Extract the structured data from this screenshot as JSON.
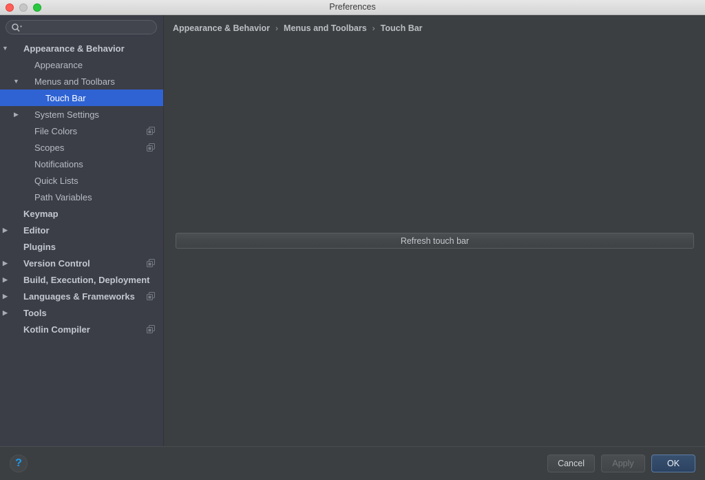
{
  "window": {
    "title": "Preferences",
    "traffic_lights": [
      "close-button",
      "minimize-button",
      "zoom-button"
    ]
  },
  "sidebar": {
    "search": {
      "value": "",
      "placeholder": "",
      "icon": "search-icon"
    },
    "items": [
      {
        "label": "Appearance & Behavior",
        "level": 0,
        "twisty": "▼",
        "bold": true,
        "selected": false,
        "badge": false
      },
      {
        "label": "Appearance",
        "level": 1,
        "twisty": "",
        "bold": false,
        "selected": false,
        "badge": false
      },
      {
        "label": "Menus and Toolbars",
        "level": 1,
        "twisty": "▼",
        "bold": false,
        "selected": false,
        "badge": false
      },
      {
        "label": "Touch Bar",
        "level": 2,
        "twisty": "",
        "bold": false,
        "selected": true,
        "badge": false
      },
      {
        "label": "System Settings",
        "level": 1,
        "twisty": "▶",
        "bold": false,
        "selected": false,
        "badge": false
      },
      {
        "label": "File Colors",
        "level": 1,
        "twisty": "",
        "bold": false,
        "selected": false,
        "badge": true
      },
      {
        "label": "Scopes",
        "level": 1,
        "twisty": "",
        "bold": false,
        "selected": false,
        "badge": true
      },
      {
        "label": "Notifications",
        "level": 1,
        "twisty": "",
        "bold": false,
        "selected": false,
        "badge": false
      },
      {
        "label": "Quick Lists",
        "level": 1,
        "twisty": "",
        "bold": false,
        "selected": false,
        "badge": false
      },
      {
        "label": "Path Variables",
        "level": 1,
        "twisty": "",
        "bold": false,
        "selected": false,
        "badge": false
      },
      {
        "label": "Keymap",
        "level": 0,
        "twisty": "",
        "bold": true,
        "selected": false,
        "badge": false
      },
      {
        "label": "Editor",
        "level": 0,
        "twisty": "▶",
        "bold": true,
        "selected": false,
        "badge": false
      },
      {
        "label": "Plugins",
        "level": 0,
        "twisty": "",
        "bold": true,
        "selected": false,
        "badge": false
      },
      {
        "label": "Version Control",
        "level": 0,
        "twisty": "▶",
        "bold": true,
        "selected": false,
        "badge": true
      },
      {
        "label": "Build, Execution, Deployment",
        "level": 0,
        "twisty": "▶",
        "bold": true,
        "selected": false,
        "badge": false
      },
      {
        "label": "Languages & Frameworks",
        "level": 0,
        "twisty": "▶",
        "bold": true,
        "selected": false,
        "badge": true
      },
      {
        "label": "Tools",
        "level": 0,
        "twisty": "▶",
        "bold": true,
        "selected": false,
        "badge": false
      },
      {
        "label": "Kotlin Compiler",
        "level": 0,
        "twisty": "",
        "bold": true,
        "selected": false,
        "badge": true
      }
    ]
  },
  "main": {
    "breadcrumb": [
      "Appearance & Behavior",
      "Menus and Toolbars",
      "Touch Bar"
    ],
    "breadcrumb_separator": "›",
    "refresh_button_label": "Refresh touch bar"
  },
  "footer": {
    "help_label": "?",
    "cancel_label": "Cancel",
    "apply_label": "Apply",
    "ok_label": "OK"
  },
  "colors": {
    "selection_blue": "#2f63d4",
    "sidebar_bg": "#3b3e47",
    "panel_bg": "#3c3f41",
    "help_blue": "#1e9bf0",
    "default_button_blue": "#38516f"
  }
}
